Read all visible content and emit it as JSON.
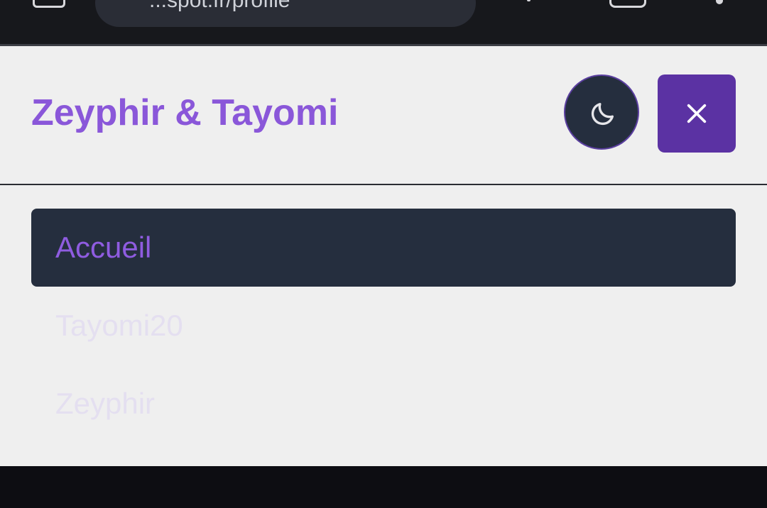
{
  "browser": {
    "url": "...spot.fr/profile"
  },
  "header": {
    "title": "Zeyphir & Tayomi"
  },
  "controls": {
    "theme_icon": "moon-icon",
    "close_icon": "close-icon"
  },
  "nav": {
    "items": [
      {
        "label": "Accueil",
        "active": true
      },
      {
        "label": "Tayomi20",
        "active": false
      },
      {
        "label": "Zeyphir",
        "active": false
      }
    ]
  },
  "colors": {
    "accent": "#8a57d9",
    "active_bg": "#252e3e",
    "close_bg": "#5b32a3",
    "panel_bg": "#efefef"
  }
}
